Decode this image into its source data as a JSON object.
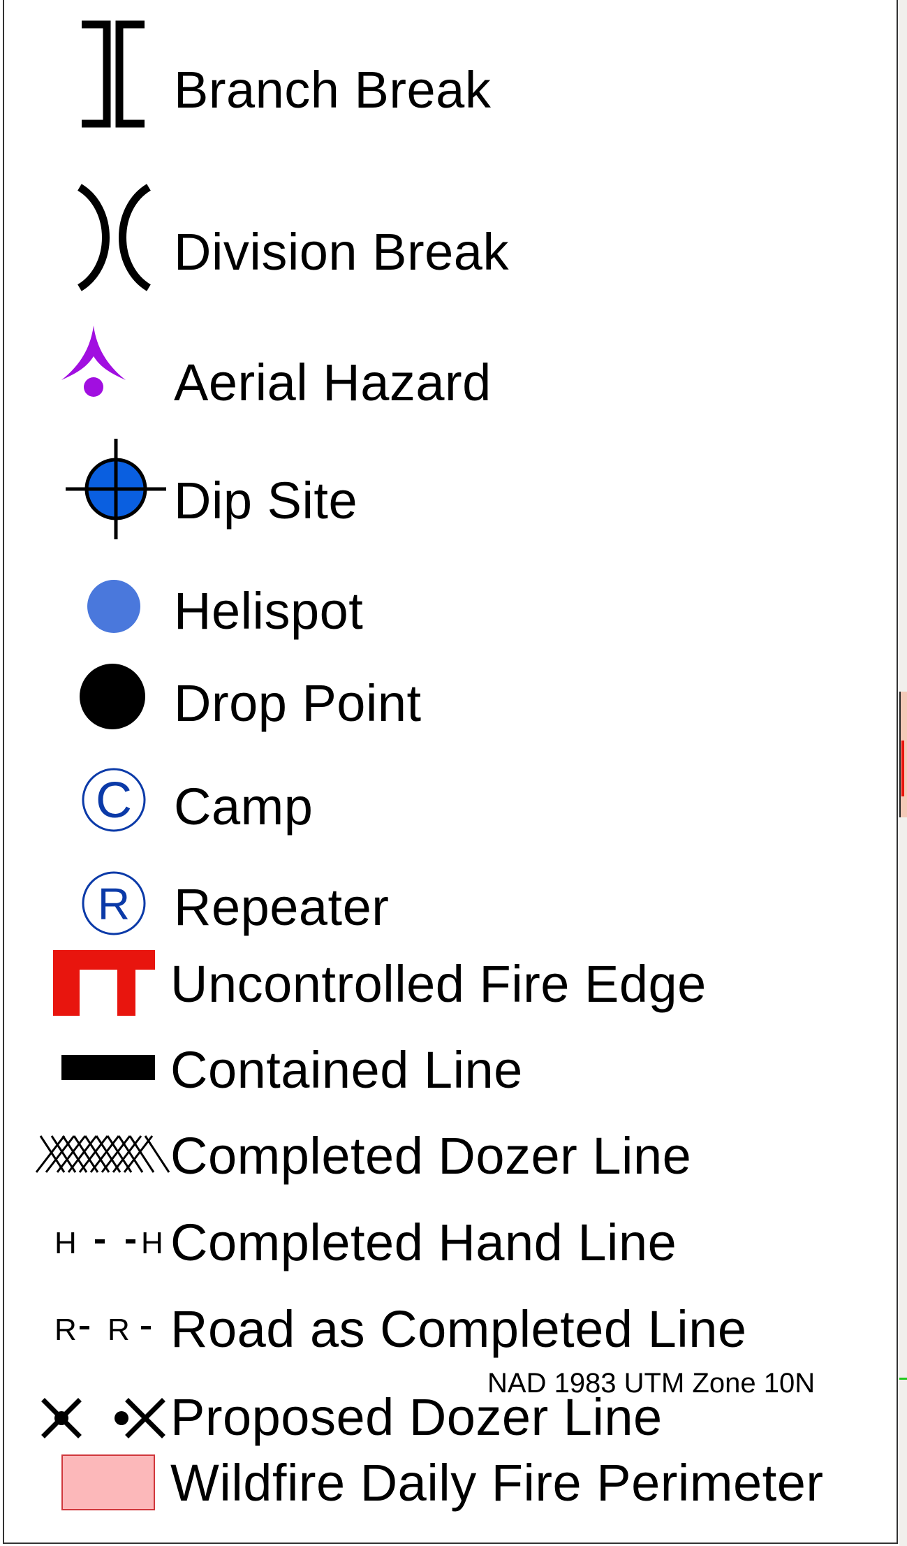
{
  "legend": {
    "items": [
      {
        "id": "branch-break",
        "label": "Branch Break",
        "icon": "branch-break-icon"
      },
      {
        "id": "division-break",
        "label": "Division Break",
        "icon": "division-break-icon"
      },
      {
        "id": "aerial-hazard",
        "label": "Aerial Hazard",
        "icon": "aerial-hazard-icon",
        "color": "#a10fe0"
      },
      {
        "id": "dip-site",
        "label": "Dip Site",
        "icon": "dip-site-icon",
        "color": "#0a5fe0"
      },
      {
        "id": "helispot",
        "label": "Helispot",
        "icon": "helispot-icon",
        "color": "#4a78dc"
      },
      {
        "id": "drop-point",
        "label": "Drop Point",
        "icon": "drop-point-icon",
        "color": "#000000"
      },
      {
        "id": "camp",
        "label": "Camp",
        "icon": "camp-icon",
        "symbol": "©",
        "color": "#0b3aa8"
      },
      {
        "id": "repeater",
        "label": "Repeater",
        "icon": "repeater-icon",
        "symbol": "®",
        "color": "#0b3aa8"
      },
      {
        "id": "uncontrolled-fire-edge",
        "label": "Uncontrolled Fire Edge",
        "icon": "uncontrolled-fire-edge-icon",
        "color": "#e8150e"
      },
      {
        "id": "contained-line",
        "label": "Contained Line",
        "icon": "contained-line-icon",
        "color": "#000000"
      },
      {
        "id": "completed-dozer-line",
        "label": "Completed Dozer Line",
        "icon": "completed-dozer-line-icon"
      },
      {
        "id": "completed-hand-line",
        "label": "Completed Hand Line",
        "icon": "completed-hand-line-icon",
        "symbol_text": "H - -H"
      },
      {
        "id": "road-as-completed-line",
        "label": "Road as Completed Line",
        "icon": "road-as-completed-line-icon",
        "symbol_text": "R-  R -"
      },
      {
        "id": "proposed-dozer-line",
        "label": "Proposed Dozer Line",
        "icon": "proposed-dozer-line-icon"
      },
      {
        "id": "wildfire-daily-fire-perimeter",
        "label": "Wildfire Daily Fire Perimeter",
        "icon": "fire-perimeter-swatch-icon",
        "color": "#fcb8ba"
      }
    ]
  },
  "projection": "NAD 1983 UTM Zone 10N"
}
